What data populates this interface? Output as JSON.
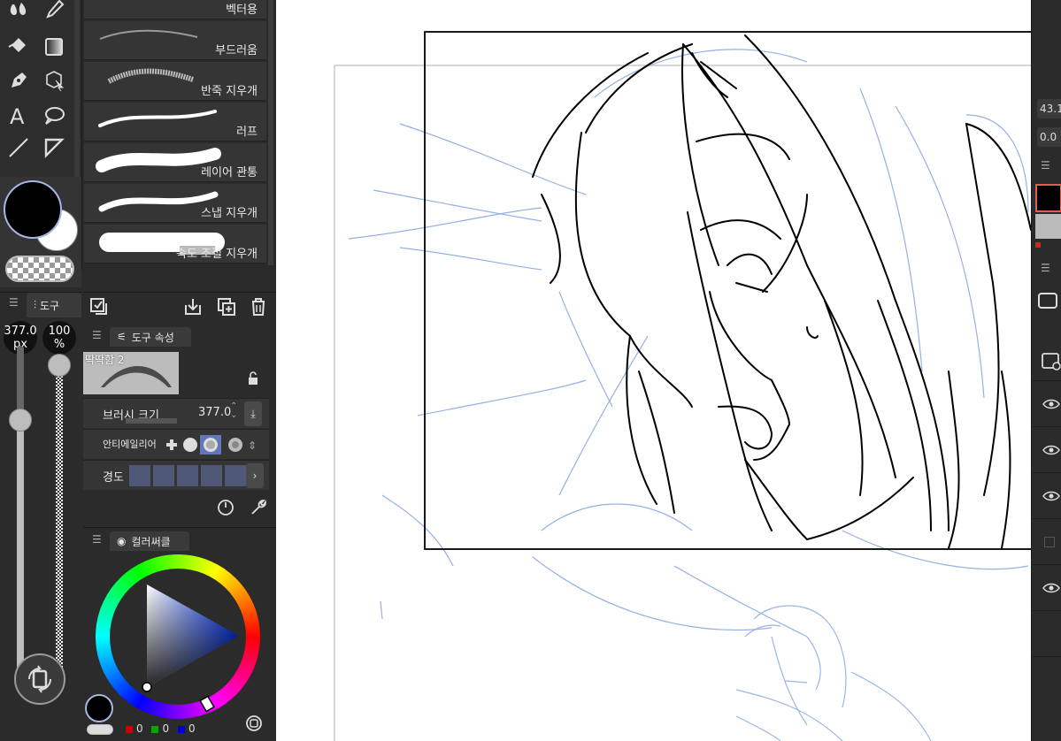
{
  "brushes": [
    {
      "label": "벡터용"
    },
    {
      "label": "부드러움"
    },
    {
      "label": "반죽 지우개"
    },
    {
      "label": "러프"
    },
    {
      "label": "레이어 관통"
    },
    {
      "label": "스냅 지우개"
    },
    {
      "label": "속도 조절 지우개"
    }
  ],
  "size_panel": {
    "tab_label": "도구",
    "size_value": "377.0",
    "size_unit": "px",
    "size_level": 0.78,
    "opacity_value": "100",
    "opacity_unit": "%",
    "opacity_level": 1.0
  },
  "tool_property": {
    "tab_label": "도구 속성",
    "preset_name": "딱딱함 2",
    "brush_size_label": "브러시 크기",
    "brush_size_value": "377.0",
    "antialias_label": "안티에일리어",
    "hardness_label": "경도"
  },
  "color_circle": {
    "tab_label": "컬러써클",
    "r": "0",
    "g": "0",
    "b": "0"
  },
  "right_panel": {
    "field_1": "43.1",
    "field_2": "0.0"
  },
  "colors": {
    "main": "#000000",
    "sub": "#ffffff",
    "accent": "#a6b7e3",
    "sketch_blue": "#8aa8e0"
  }
}
